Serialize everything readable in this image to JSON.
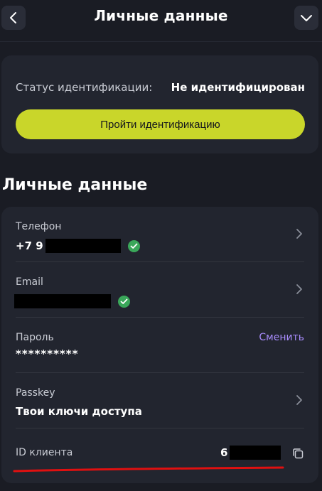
{
  "header": {
    "title": "Личные данные",
    "back_icon": "chevron-left-icon",
    "menu_icon": "chevron-down-icon"
  },
  "identification": {
    "status_label": "Статус идентификации:",
    "status_value": "Не идентифицирован",
    "verify_button": "Пройти идентификацию",
    "accent_color": "#c9d62a"
  },
  "section": {
    "title": "Личные данные"
  },
  "rows": {
    "phone": {
      "label": "Телефон",
      "value_prefix": "+7 9",
      "verified": true
    },
    "email": {
      "label": "Email",
      "verified": true
    },
    "password": {
      "label": "Пароль",
      "value": "**********",
      "action": "Сменить"
    },
    "passkey": {
      "label": "Passkey",
      "value": "Твои ключи доступа"
    },
    "client_id": {
      "label": "ID клиента",
      "value_prefix": "6"
    }
  },
  "colors": {
    "background": "#1a1c24",
    "card": "#22252f",
    "verified": "#3aa75a",
    "link": "#a78bfa",
    "annotation": "#e01010"
  }
}
